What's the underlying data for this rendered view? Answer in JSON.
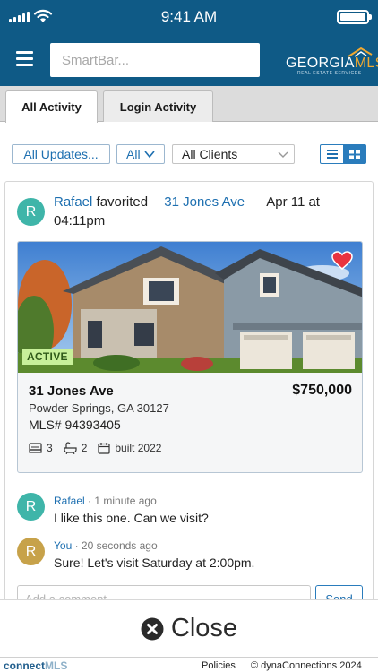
{
  "status_bar": {
    "time": "9:41 AM"
  },
  "header": {
    "smartbar_placeholder": "SmartBar...",
    "logo": {
      "main": "GEORGIA",
      "accent": "MLS",
      "sub": "REAL ESTATE SERVICES"
    }
  },
  "tabs": [
    {
      "label": "All Activity",
      "active": true
    },
    {
      "label": "Login Activity",
      "active": false
    }
  ],
  "filters": {
    "updates": "All Updates...",
    "type": "All",
    "clients": "All Clients"
  },
  "activity": {
    "user": "Rafael",
    "action": "favorited",
    "address": "31 Jones Ave",
    "date": "Apr 11 at 04:11pm",
    "avatar_initial": "R",
    "listing": {
      "status": "ACTIVE",
      "address": "31 Jones Ave",
      "price": "$750,000",
      "city": "Powder Springs, GA 30127",
      "mls_label": "MLS#",
      "mls_number": "94393405",
      "beds": "3",
      "baths": "2",
      "built": "built 2022",
      "favorited": true
    },
    "comments": [
      {
        "initial": "R",
        "author": "Rafael",
        "time": "· 1 minute ago",
        "text": "I like this one. Can we visit?",
        "color": "#3fb5a9"
      },
      {
        "initial": "R",
        "author": "You",
        "time": "· 20 seconds ago",
        "text": "Sure! Let's visit Saturday at 2:00pm.",
        "color": "#c7a24a"
      }
    ],
    "comment_placeholder": "Add a comment...",
    "send_label": "Send"
  },
  "close_label": "Close",
  "footer": {
    "brand_main": "connect",
    "brand_accent": "MLS",
    "policies": "Policies",
    "copyright": "© dynaConnections 2024"
  },
  "colors": {
    "header": "#0f5a86",
    "link": "#1d6fb0",
    "active_badge": "#c8f09a",
    "heart": "#e8333f"
  }
}
